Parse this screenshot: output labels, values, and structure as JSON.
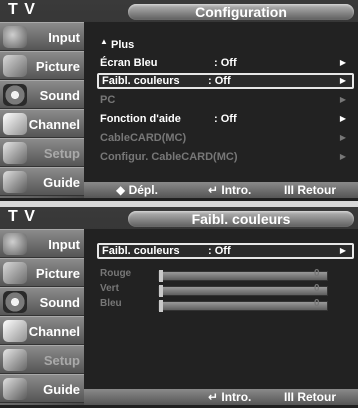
{
  "tv_label": "T V",
  "panels": [
    {
      "title": "Configuration",
      "selected_sidebar": "Setup",
      "menu_items": [
        {
          "label": "Plus",
          "value": "",
          "arrow": "",
          "style": "normal"
        },
        {
          "label": "Écran Bleu",
          "value": ": Off",
          "arrow": "▶",
          "style": "normal"
        },
        {
          "label": "Faibl. couleurs",
          "value": ": Off",
          "arrow": "▶",
          "style": "selected"
        },
        {
          "label": "PC",
          "value": "",
          "arrow": "▶",
          "style": "dim"
        },
        {
          "label": "Fonction d'aide",
          "value": ": Off",
          "arrow": "▶",
          "style": "normal"
        },
        {
          "label": "CableCARD(MC)",
          "value": "",
          "arrow": "▶",
          "style": "dim"
        },
        {
          "label": "Configur. CableCARD(MC)",
          "value": "",
          "arrow": "▶",
          "style": "dim"
        }
      ],
      "footer": {
        "move": "◆ Dépl.",
        "enter": "↵ Intro.",
        "return": "III Retour"
      }
    },
    {
      "title": "Faibl. couleurs",
      "selected_sidebar": "Setup",
      "menu_items": [
        {
          "label": "Faibl. couleurs",
          "value": ": Off",
          "arrow": "▶",
          "style": "selected"
        }
      ],
      "sliders": [
        {
          "label": "Rouge",
          "value": "0"
        },
        {
          "label": "Vert",
          "value": "0"
        },
        {
          "label": "Bleu",
          "value": "0"
        }
      ],
      "footer": {
        "enter": "↵ Intro.",
        "return": "III Retour"
      }
    }
  ],
  "sidebar": [
    {
      "label": "Input",
      "icon": "input-icon"
    },
    {
      "label": "Picture",
      "icon": "picture-icon"
    },
    {
      "label": "Sound",
      "icon": "sound-icon"
    },
    {
      "label": "Channel",
      "icon": "channel-icon"
    },
    {
      "label": "Setup",
      "icon": "setup-icon"
    },
    {
      "label": "Guide",
      "icon": "guide-icon"
    }
  ],
  "colors": {
    "accent": "#ffffff",
    "panel_bg": "#222222",
    "dim_text": "#777777"
  }
}
